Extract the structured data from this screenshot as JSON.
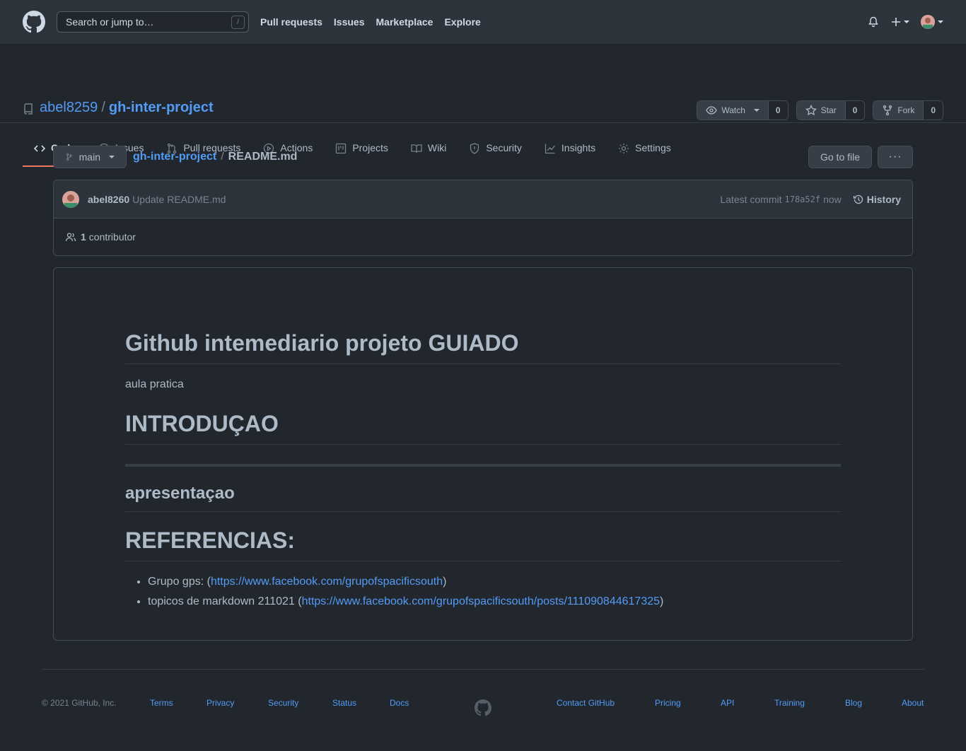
{
  "header": {
    "search_placeholder": "Search or jump to…",
    "search_shortcut": "/",
    "nav": [
      "Pull requests",
      "Issues",
      "Marketplace",
      "Explore"
    ]
  },
  "repo": {
    "owner": "abel8259",
    "separator": "/",
    "name": "gh-inter-project",
    "watch_label": "Watch",
    "watch_count": "0",
    "star_label": "Star",
    "star_count": "0",
    "fork_label": "Fork",
    "fork_count": "0"
  },
  "tabs": [
    {
      "label": "Code",
      "icon": "code-icon",
      "active": true
    },
    {
      "label": "Issues",
      "icon": "issue-icon"
    },
    {
      "label": "Pull requests",
      "icon": "pull-request-icon"
    },
    {
      "label": "Actions",
      "icon": "play-icon"
    },
    {
      "label": "Projects",
      "icon": "project-icon"
    },
    {
      "label": "Wiki",
      "icon": "book-icon"
    },
    {
      "label": "Security",
      "icon": "shield-icon"
    },
    {
      "label": "Insights",
      "icon": "graph-icon"
    },
    {
      "label": "Settings",
      "icon": "gear-icon"
    }
  ],
  "file_nav": {
    "branch": "main",
    "repo_crumb": "gh-inter-project",
    "crumb_sep": "/",
    "file": "README.md",
    "goto_label": "Go to file",
    "more_label": "···"
  },
  "commit": {
    "author": "abel8260",
    "message": "Update README.md",
    "latest_label": "Latest commit",
    "sha": "178a52f",
    "time": "now",
    "history_label": "History",
    "contributors_count": "1",
    "contributors_label": "contributor"
  },
  "readme": {
    "h1": "Github intemediario projeto GUIADO",
    "p1": "aula pratica",
    "h_intro": "INTRODUÇAO",
    "h_apresentacao": "apresentaçao",
    "h_refs": "REFERENCIAS:",
    "list": [
      {
        "prefix": "Grupo gps: (",
        "link": "https://www.facebook.com/grupofspacificsouth",
        "suffix": ")"
      },
      {
        "prefix": "topicos de markdown 211021 (",
        "link": "https://www.facebook.com/grupofspacificsouth/posts/111090844617325",
        "suffix": ")"
      }
    ]
  },
  "footer": {
    "copyright": "© 2021 GitHub, Inc.",
    "left_links": [
      "Terms",
      "Privacy",
      "Security",
      "Status",
      "Docs"
    ],
    "right_links": [
      "Contact GitHub",
      "Pricing",
      "API",
      "Training",
      "Blog",
      "About"
    ]
  },
  "colors": {
    "accent_link": "#539bf5",
    "tab_underline": "#ec775c",
    "background": "#22272e"
  }
}
